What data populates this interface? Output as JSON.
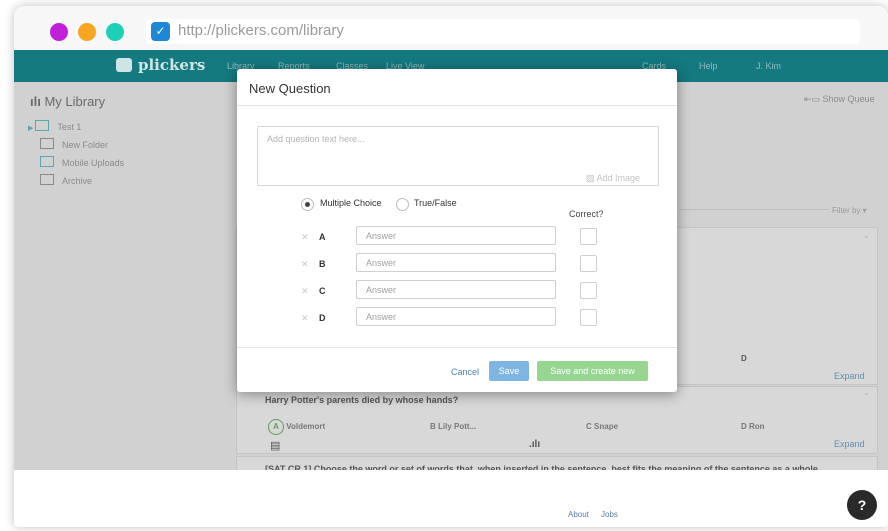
{
  "browser": {
    "url": "http://plickers.com/library",
    "traffic_colors": [
      "#c21fd8",
      "#f6a621",
      "#1fd0b8"
    ]
  },
  "nav": {
    "brand": "plickers",
    "items": [
      "Library",
      "Reports",
      "Classes",
      "Live View"
    ],
    "right_items": [
      "Cards",
      "Help",
      "J. Kim"
    ]
  },
  "sidebar": {
    "title": "My Library",
    "items": [
      "Test 1",
      "New Folder",
      "Mobile Uploads",
      "Archive"
    ]
  },
  "toolbar": {
    "show_queue": "Show Queue",
    "filter": "Filter by"
  },
  "cards": [
    {
      "answer_d": "D",
      "expand": "Expand"
    },
    {
      "question": "Harry Potter's parents died by whose hands?",
      "answers": [
        {
          "letter": "A",
          "text": "Voldemort",
          "correct": true
        },
        {
          "letter": "B",
          "text": "Lily Pott...",
          "correct": false
        },
        {
          "letter": "C",
          "text": "Snape",
          "correct": false
        },
        {
          "letter": "D",
          "text": "Ron",
          "correct": false
        }
      ],
      "expand": "Expand"
    },
    {
      "question": "[SAT CR 1] Choose the word or set of words that, when inserted in the sentence, best fits the meaning of the sentence as a whole."
    }
  ],
  "footer": {
    "links": [
      "About",
      "Jobs"
    ],
    "help_icon": "?"
  },
  "modal": {
    "title": "New Question",
    "question_placeholder": "Add question text here...",
    "add_image": "Add Image",
    "types": [
      "Multiple Choice",
      "True/False"
    ],
    "selected_type": "Multiple Choice",
    "correct_header": "Correct?",
    "answer_placeholder": "Answer",
    "rows": [
      {
        "letter": "A",
        "value": "",
        "correct": false
      },
      {
        "letter": "B",
        "value": "",
        "correct": false
      },
      {
        "letter": "C",
        "value": "",
        "correct": false
      },
      {
        "letter": "D",
        "value": "",
        "correct": false
      }
    ],
    "cancel": "Cancel",
    "save": "Save",
    "save_new": "Save and create new",
    "save_color": "#7fb5e3",
    "save_new_color": "#97d691"
  }
}
